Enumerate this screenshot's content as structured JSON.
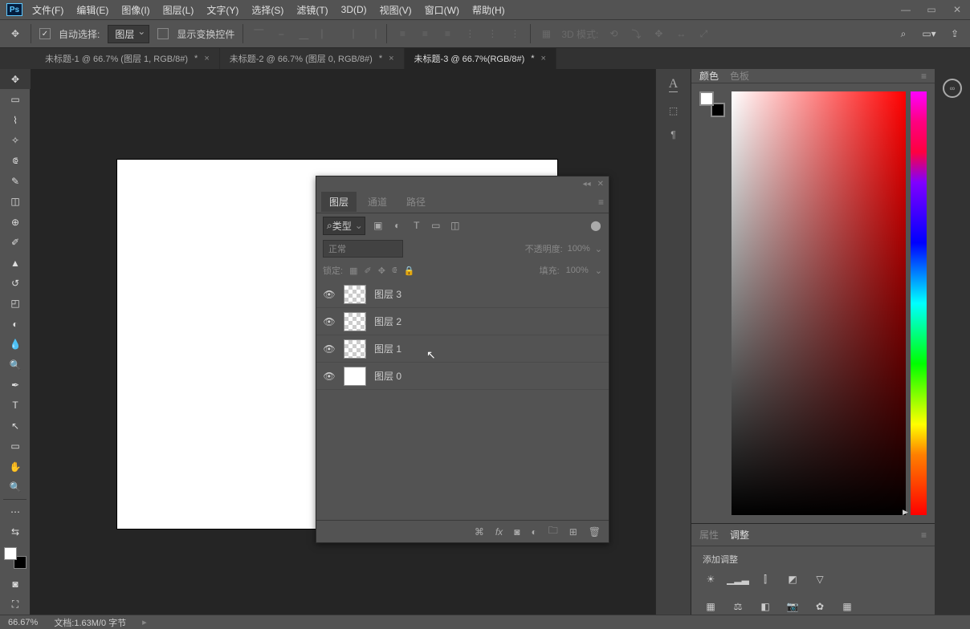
{
  "menu": {
    "items": [
      "文件(F)",
      "编辑(E)",
      "图像(I)",
      "图层(L)",
      "文字(Y)",
      "选择(S)",
      "滤镜(T)",
      "3D(D)",
      "视图(V)",
      "窗口(W)",
      "帮助(H)"
    ]
  },
  "optbar": {
    "auto_select": "自动选择:",
    "auto_select_target": "图层",
    "show_transform": "显示变换控件",
    "mode3d": "3D 模式:"
  },
  "tabs": [
    {
      "label": "未标题-1 @ 66.7% (图层 1, RGB/8#)",
      "dirty": "*",
      "active": false
    },
    {
      "label": "未标题-2 @ 66.7% (图层 0, RGB/8#)",
      "dirty": "*",
      "active": false
    },
    {
      "label": "未标题-3 @ 66.7%(RGB/8#)",
      "dirty": "*",
      "active": true
    }
  ],
  "tools": [
    "move",
    "marquee",
    "lasso",
    "wand",
    "crop",
    "eyedropper",
    "ruler",
    "heal",
    "brush",
    "stamp",
    "history",
    "eraser",
    "gradient",
    "blur",
    "dodge",
    "pen",
    "text",
    "path",
    "shape",
    "hand",
    "zoom"
  ],
  "layers_panel": {
    "tabs": {
      "layers": "图层",
      "channels": "通道",
      "paths": "路径"
    },
    "filter_label": "类型",
    "blend_mode": "正常",
    "opacity_label": "不透明度:",
    "opacity_value": "100%",
    "lock_label": "锁定:",
    "fill_label": "填充:",
    "fill_value": "100%",
    "layers": [
      {
        "name": "图层 3",
        "thumb": "checker"
      },
      {
        "name": "图层 2",
        "thumb": "checker"
      },
      {
        "name": "图层 1",
        "thumb": "checker"
      },
      {
        "name": "图层 0",
        "thumb": "white"
      }
    ]
  },
  "right": {
    "color_tab": "颜色",
    "swatch_tab": "色板",
    "props_tab": "属性",
    "adjust_tab": "调整",
    "adjust_label": "添加调整"
  },
  "status": {
    "zoom": "66.67%",
    "doc": "文档:1.63M/0 字节"
  }
}
